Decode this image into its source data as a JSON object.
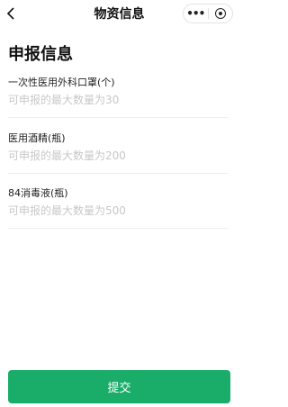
{
  "navbar": {
    "title": "物资信息",
    "more_label": "•••",
    "back_icon": "chevron-left-icon",
    "close_icon": "target-icon"
  },
  "form": {
    "section_title": "申报信息",
    "fields": [
      {
        "label": "一次性医用外科口罩(个)",
        "placeholder": "可申报的最大数量为30",
        "value": ""
      },
      {
        "label": "医用酒精(瓶)",
        "placeholder": "可申报的最大数量为200",
        "value": ""
      },
      {
        "label": "84消毒液(瓶)",
        "placeholder": "可申报的最大数量为500",
        "value": ""
      }
    ]
  },
  "submit": {
    "label": "提交",
    "color": "#1aad6a"
  }
}
